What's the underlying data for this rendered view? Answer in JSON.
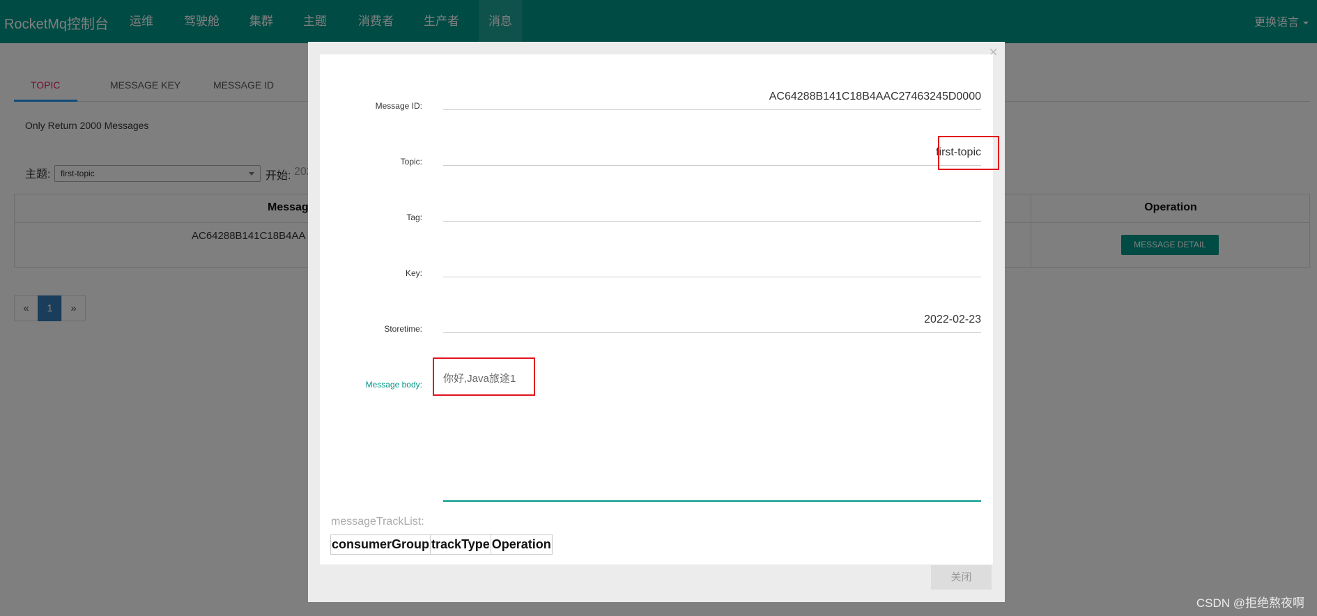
{
  "nav": {
    "brand": "RocketMq控制台",
    "items": [
      "运维",
      "驾驶舱",
      "集群",
      "主题",
      "消费者",
      "生产者",
      "消息"
    ],
    "active": "消息",
    "lang": "更换语言"
  },
  "page": {
    "tabs": [
      "TOPIC",
      "MESSAGE KEY",
      "MESSAGE ID"
    ],
    "note": "Only Return 2000 Messages",
    "topic_label": "主题:",
    "topic_value": "first-topic",
    "start_label": "开始:",
    "start_value": "202",
    "table": {
      "header_message": "Messag",
      "header_operation": "Operation",
      "row_message_id": "AC64288B141C18B4AA",
      "detail_button": "MESSAGE DETAIL"
    },
    "pager": [
      "«",
      "1",
      "»"
    ]
  },
  "modal": {
    "close_icon": "×",
    "fields": {
      "message_id": {
        "label": "Message ID:",
        "value": "AC64288B141C18B4AAC27463245D0000"
      },
      "topic": {
        "label": "Topic:",
        "value": "first-topic"
      },
      "tag": {
        "label": "Tag:",
        "value": ""
      },
      "key": {
        "label": "Key:",
        "value": ""
      },
      "storetime": {
        "label": "Storetime:",
        "value": "2022-02-23"
      },
      "message_body": {
        "label": "Message body:",
        "value": "你好,Java旅途1"
      }
    },
    "track_list_label": "messageTrackList:",
    "track_columns": [
      "consumerGroup",
      "trackType",
      "Operation"
    ],
    "close_button": "关闭"
  },
  "watermark": "CSDN @拒绝熬夜啊"
}
